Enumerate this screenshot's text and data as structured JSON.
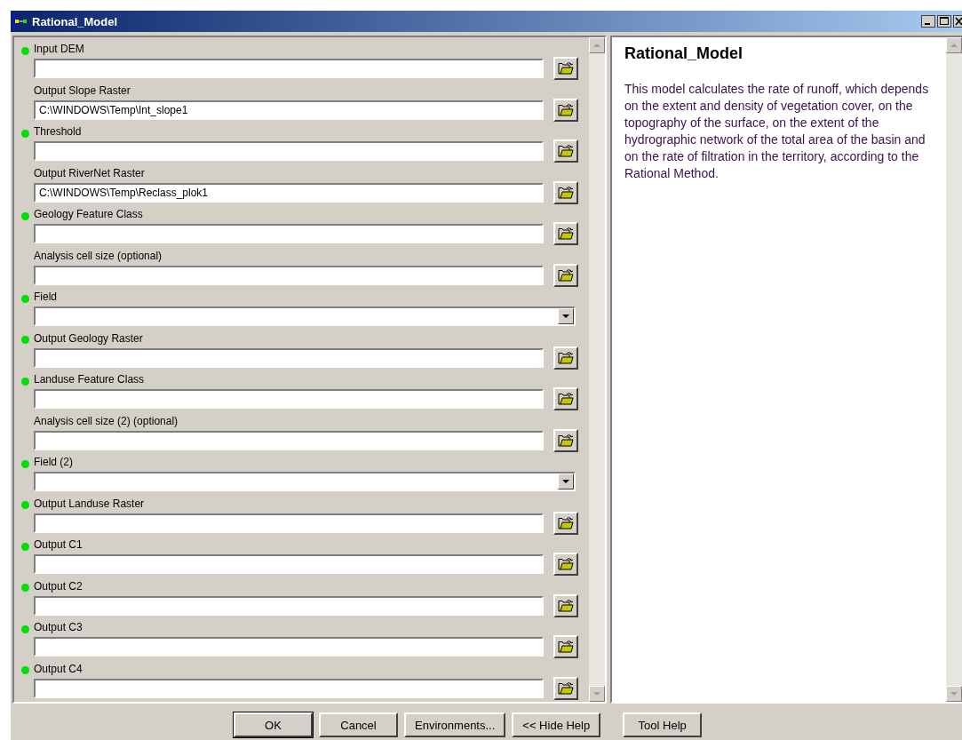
{
  "window": {
    "title": "Rational_Model"
  },
  "parameters": [
    {
      "label": "Input DEM",
      "required": true,
      "kind": "file"
    },
    {
      "label": "Output Slope Raster",
      "required": false,
      "kind": "file",
      "value": "C:\\WINDOWS\\Temp\\Int_slope1"
    },
    {
      "label": "Threshold",
      "required": true,
      "kind": "file"
    },
    {
      "label": "Output RiverNet Raster",
      "required": false,
      "kind": "file",
      "value": "C:\\WINDOWS\\Temp\\Reclass_plok1"
    },
    {
      "label": "Geology Feature Class",
      "required": true,
      "kind": "file"
    },
    {
      "label": "Analysis cell size (optional)",
      "required": false,
      "kind": "file"
    },
    {
      "label": "Field",
      "required": true,
      "kind": "dropdown"
    },
    {
      "label": "Output Geology Raster",
      "required": true,
      "kind": "file"
    },
    {
      "label": "Landuse Feature Class",
      "required": true,
      "kind": "file"
    },
    {
      "label": "Analysis cell size (2) (optional)",
      "required": false,
      "kind": "file"
    },
    {
      "label": "Field (2)",
      "required": true,
      "kind": "dropdown"
    },
    {
      "label": "Output Landuse Raster",
      "required": true,
      "kind": "file"
    },
    {
      "label": "Output C1",
      "required": true,
      "kind": "file"
    },
    {
      "label": "Output C2",
      "required": true,
      "kind": "file"
    },
    {
      "label": "Output C3",
      "required": true,
      "kind": "file"
    },
    {
      "label": "Output C4",
      "required": true,
      "kind": "file"
    }
  ],
  "help": {
    "title": "Rational_Model",
    "text": "This model calculates the rate of runoff, which depends on the extent and density of vegetation cover, on the topography of the surface, on the extent of the hydrographic network of the total area of the basin and on the rate of filtration in the territory, according to the Rational Method."
  },
  "buttons": [
    {
      "label": "OK",
      "default": true
    },
    {
      "label": "Cancel",
      "default": false
    },
    {
      "label": "Environments...",
      "default": false
    },
    {
      "label": "<< Hide Help",
      "default": false
    },
    {
      "label": "Tool Help",
      "default": false
    }
  ]
}
